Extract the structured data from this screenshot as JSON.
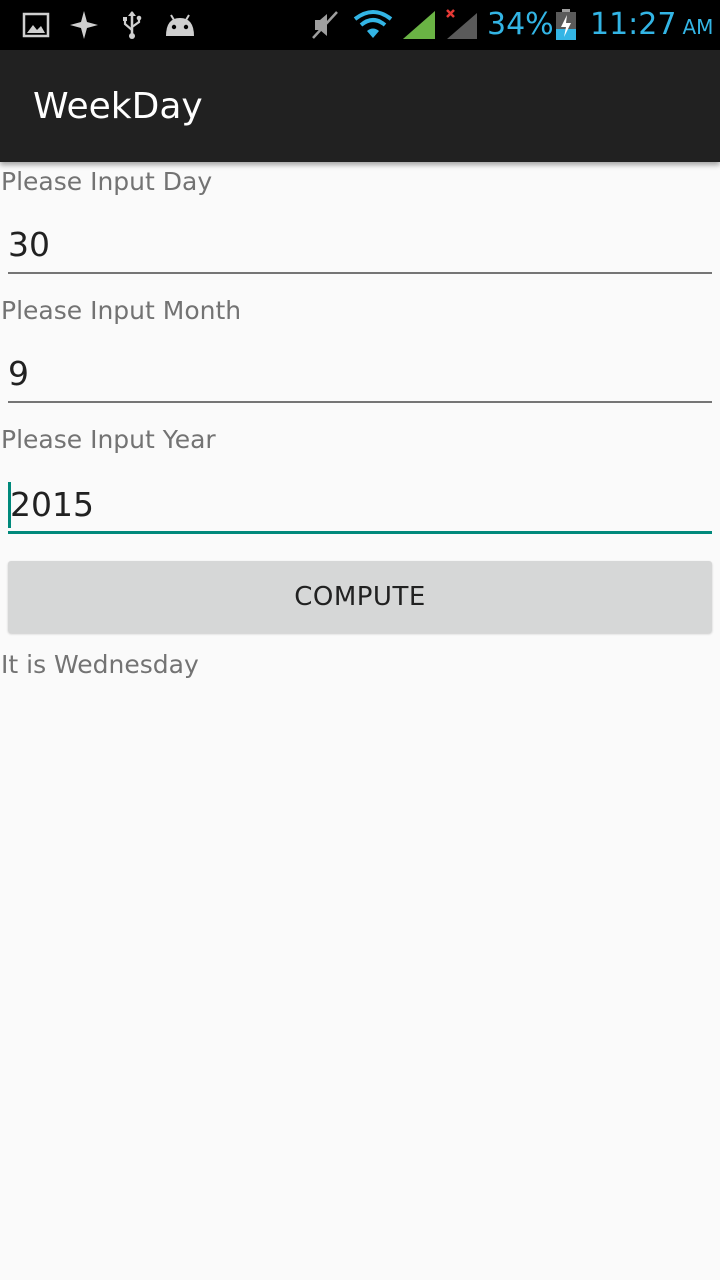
{
  "status_bar": {
    "battery": "34%",
    "time": "11:27",
    "ampm": "AM",
    "icons": [
      "gallery-icon",
      "sparkle-icon",
      "usb-icon",
      "android-debug-icon",
      "mute-icon",
      "wifi-icon",
      "signal-icon",
      "signal-no-service-icon",
      "battery-charging-icon"
    ],
    "accent_color": "#33b5e5"
  },
  "action_bar": {
    "title": "WeekDay"
  },
  "form": {
    "day": {
      "label": "Please Input Day",
      "value": "30"
    },
    "month": {
      "label": "Please Input Month",
      "value": "9"
    },
    "year": {
      "label": "Please Input Year",
      "value": "2015"
    },
    "compute_label": "COMPUTE",
    "result": "It is Wednesday",
    "focus_color": "#00897b"
  }
}
